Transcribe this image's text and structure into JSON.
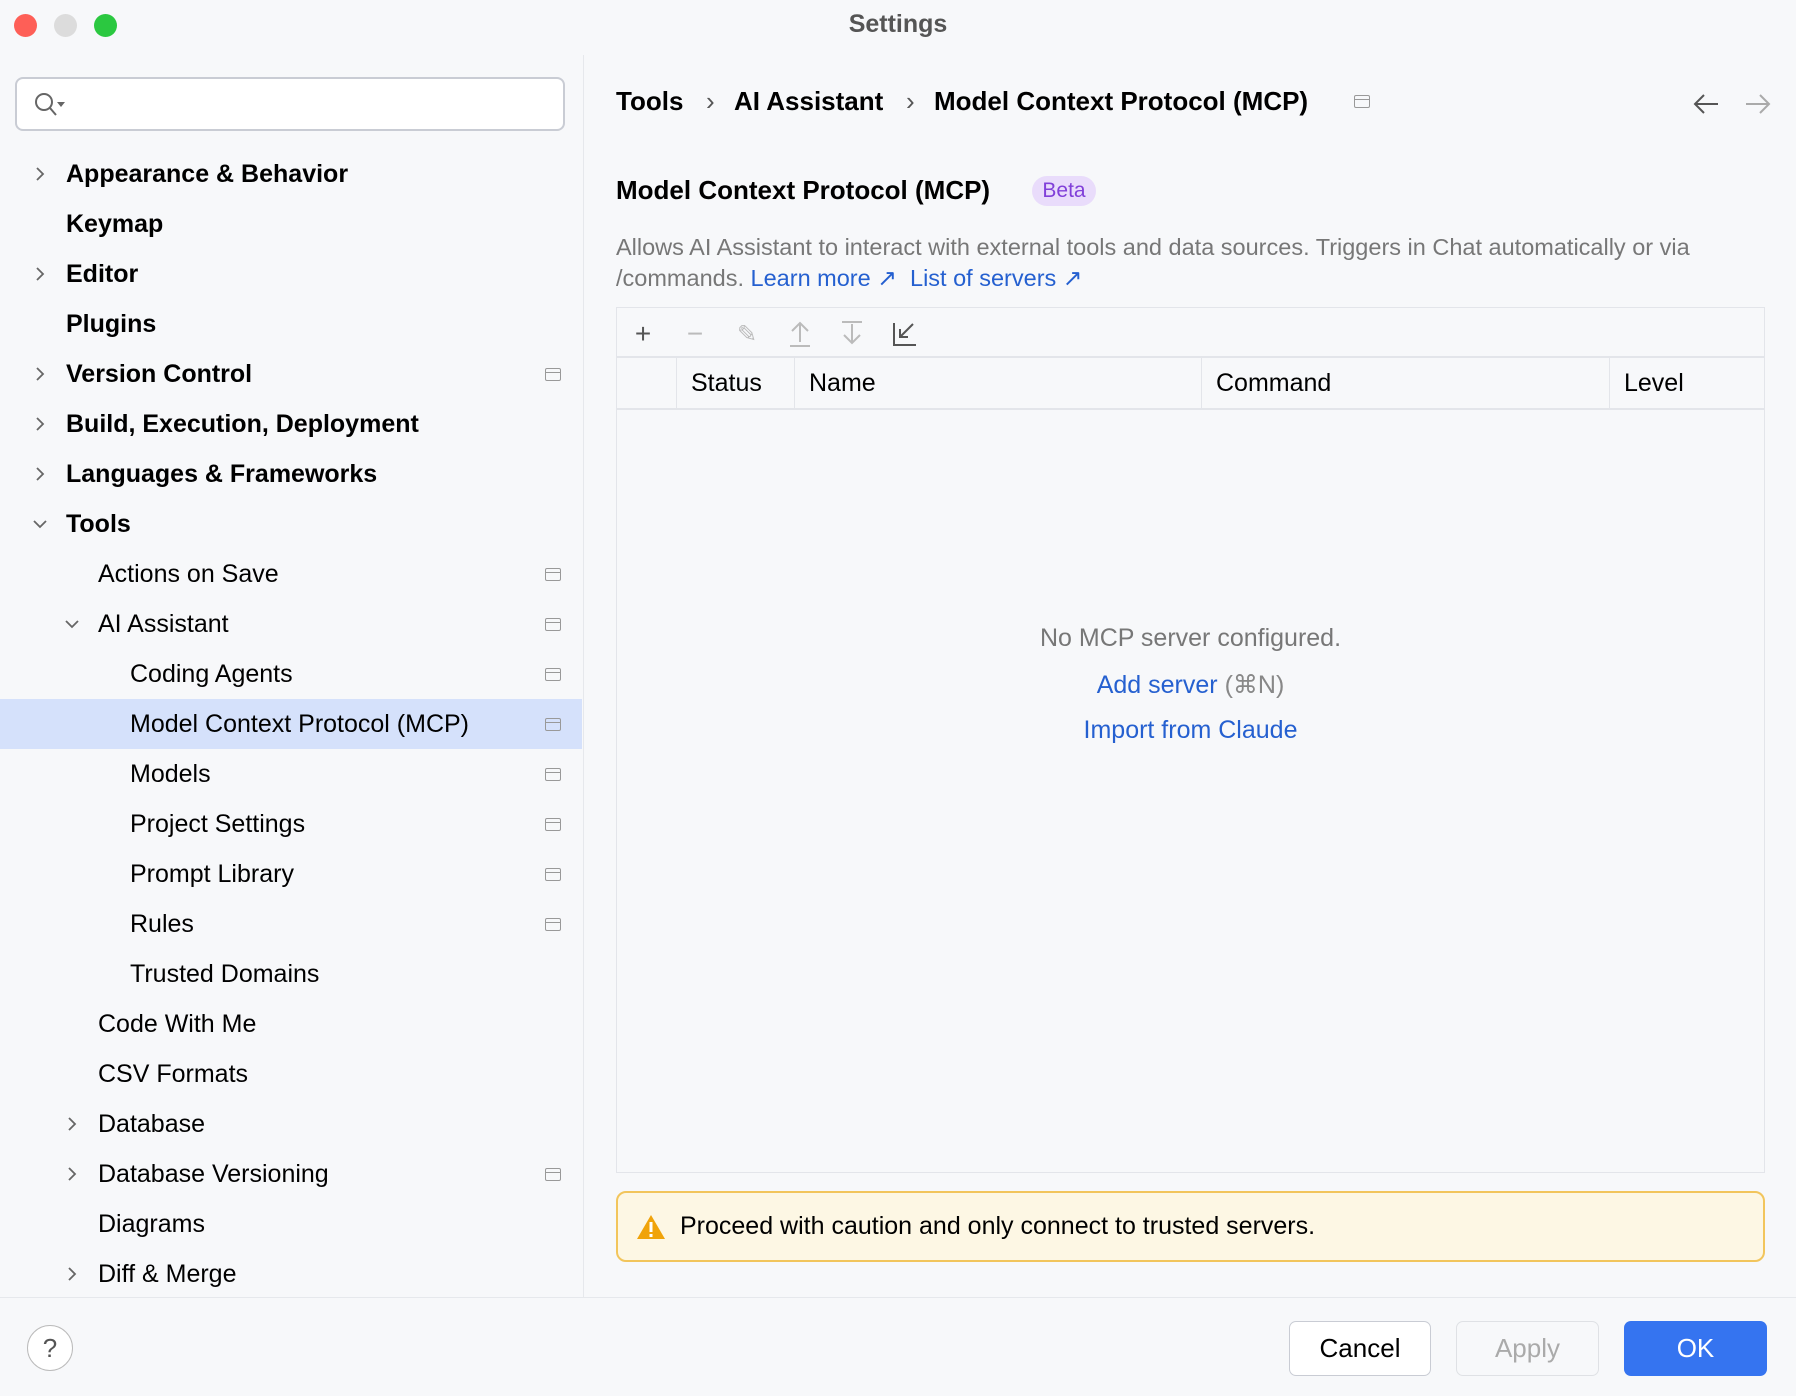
{
  "window": {
    "title": "Settings"
  },
  "search": {
    "placeholder": ""
  },
  "sidebar": {
    "items": [
      {
        "label": "Appearance & Behavior",
        "level": 0,
        "chevron": "right",
        "bold": true,
        "pin": false
      },
      {
        "label": "Keymap",
        "level": 0,
        "chevron": "",
        "bold": true,
        "pin": false
      },
      {
        "label": "Editor",
        "level": 0,
        "chevron": "right",
        "bold": true,
        "pin": false
      },
      {
        "label": "Plugins",
        "level": 0,
        "chevron": "",
        "bold": true,
        "pin": false
      },
      {
        "label": "Version Control",
        "level": 0,
        "chevron": "right",
        "bold": true,
        "pin": true
      },
      {
        "label": "Build, Execution, Deployment",
        "level": 0,
        "chevron": "right",
        "bold": true,
        "pin": false
      },
      {
        "label": "Languages & Frameworks",
        "level": 0,
        "chevron": "right",
        "bold": true,
        "pin": false
      },
      {
        "label": "Tools",
        "level": 0,
        "chevron": "down",
        "bold": true,
        "pin": false
      },
      {
        "label": "Actions on Save",
        "level": 1,
        "chevron": "",
        "bold": false,
        "pin": true
      },
      {
        "label": "AI Assistant",
        "level": 1,
        "chevron": "down",
        "bold": false,
        "pin": true
      },
      {
        "label": "Coding Agents",
        "level": 2,
        "chevron": "",
        "bold": false,
        "pin": true
      },
      {
        "label": "Model Context Protocol (MCP)",
        "level": 2,
        "chevron": "",
        "bold": false,
        "pin": true,
        "selected": true
      },
      {
        "label": "Models",
        "level": 2,
        "chevron": "",
        "bold": false,
        "pin": true
      },
      {
        "label": "Project Settings",
        "level": 2,
        "chevron": "",
        "bold": false,
        "pin": true
      },
      {
        "label": "Prompt Library",
        "level": 2,
        "chevron": "",
        "bold": false,
        "pin": true
      },
      {
        "label": "Rules",
        "level": 2,
        "chevron": "",
        "bold": false,
        "pin": true
      },
      {
        "label": "Trusted Domains",
        "level": 2,
        "chevron": "",
        "bold": false,
        "pin": false
      },
      {
        "label": "Code With Me",
        "level": 1,
        "chevron": "",
        "bold": false,
        "pin": false
      },
      {
        "label": "CSV Formats",
        "level": 1,
        "chevron": "",
        "bold": false,
        "pin": false
      },
      {
        "label": "Database",
        "level": 1,
        "chevron": "right",
        "bold": false,
        "pin": false
      },
      {
        "label": "Database Versioning",
        "level": 1,
        "chevron": "right",
        "bold": false,
        "pin": true
      },
      {
        "label": "Diagrams",
        "level": 1,
        "chevron": "",
        "bold": false,
        "pin": false
      },
      {
        "label": "Diff & Merge",
        "level": 1,
        "chevron": "right",
        "bold": false,
        "pin": false
      }
    ]
  },
  "breadcrumb": {
    "items": [
      "Tools",
      "AI Assistant",
      "Model Context Protocol (MCP)"
    ],
    "sep": "›"
  },
  "main": {
    "heading": "Model Context Protocol (MCP)",
    "badge": "Beta",
    "description": "Allows AI Assistant to interact with external tools and data sources. Triggers in Chat automatically or via /commands.",
    "learn_more": "Learn more ↗",
    "list_servers": "List of servers ↗",
    "table": {
      "columns": [
        "Status",
        "Name",
        "Command",
        "Level"
      ],
      "empty_text": "No MCP server configured.",
      "add_server": "Add server",
      "add_shortcut": "(⌘N)",
      "import": "Import from Claude"
    },
    "warning": "Proceed with caution and only connect to trusted servers."
  },
  "footer": {
    "help": "?",
    "cancel": "Cancel",
    "apply": "Apply",
    "ok": "OK"
  },
  "colors": {
    "accent": "#3574f0",
    "link": "#2560d0",
    "selection": "#d5e1fb",
    "badge_bg": "#e9dcfb",
    "badge_fg": "#8140d9",
    "warning_bg": "#fdf7e4",
    "warning_border": "#f2c55c"
  }
}
